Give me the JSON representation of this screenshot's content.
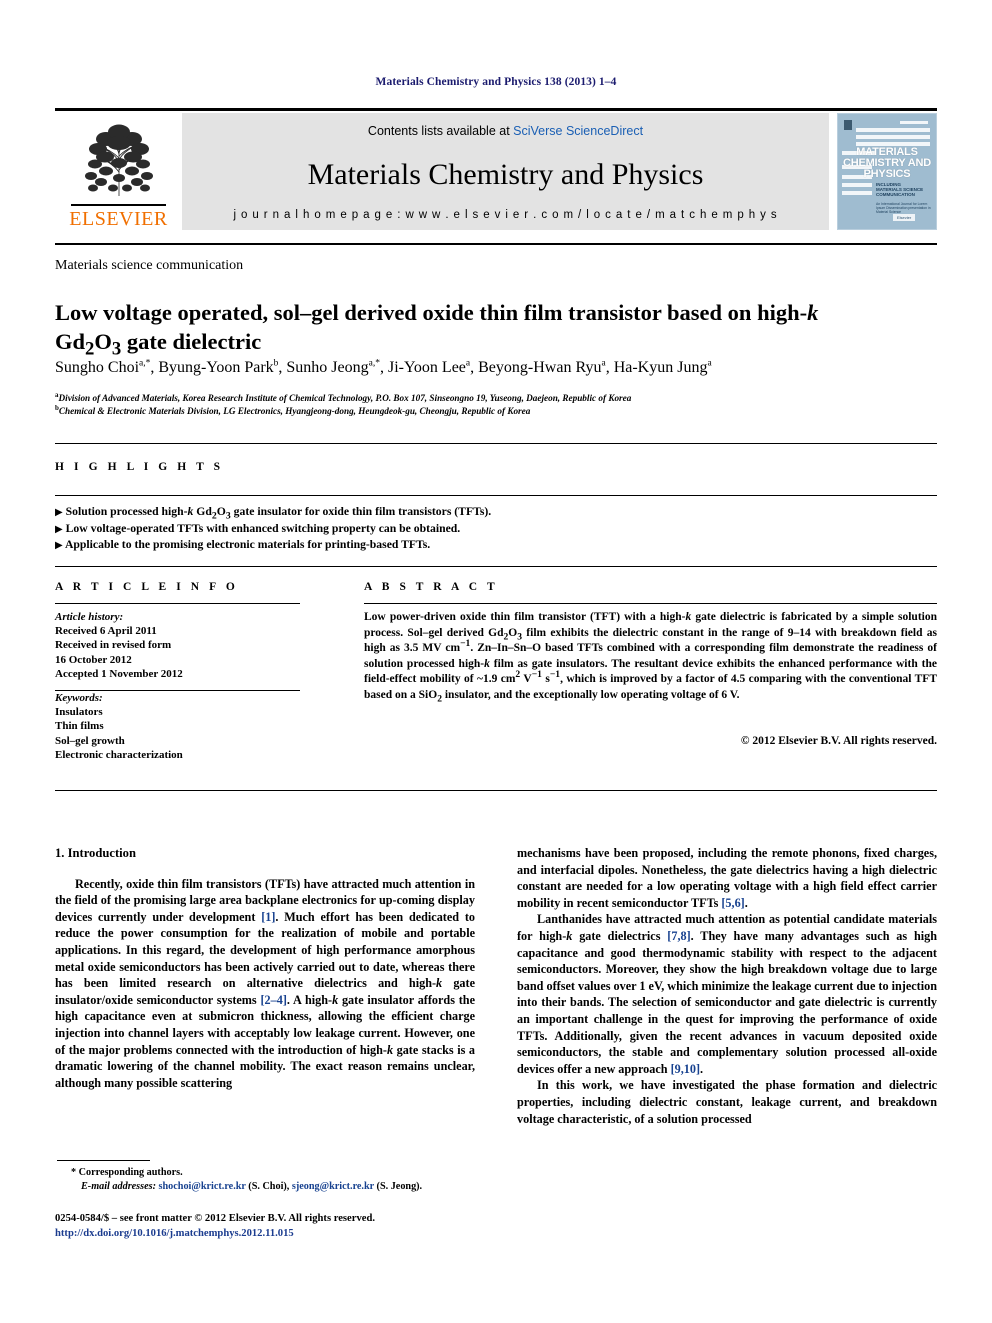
{
  "running_head": "Materials Chemistry and Physics 138 (2013) 1–4",
  "masthead": {
    "publisher_logo_text": "ELSEVIER",
    "contents_prefix": "Contents lists available at ",
    "contents_link": "SciVerse ScienceDirect",
    "journal_title": "Materials Chemistry and Physics",
    "homepage": "j o u r n a l   h o m e p a g e :   w w w . e l s e v i e r . c o m / l o c a t e / m a t c h e m p h y s",
    "cover": {
      "title_line1": "MATERIALS",
      "title_line2": "CHEMISTRY AND",
      "title_line3": "PHYSICS",
      "sub_line1": "INCLUDING",
      "sub_line2": "MATERIALS SCIENCE",
      "sub_line3": "COMMUNICATION",
      "blurb": "An International Journal for Lorem Ipsum Dissemination presentation in Material Science",
      "footer": "Elsevier"
    }
  },
  "article": {
    "section_type": "Materials science communication",
    "title_line1": "Low voltage operated, sol–gel derived oxide thin film transistor based on high-",
    "title_italic_k": "k",
    "title_line2_pre": "Gd",
    "title_line2_sub1": "2",
    "title_line2_mid": "O",
    "title_line2_sub2": "3",
    "title_line2_post": " gate dielectric",
    "authors": [
      {
        "name": "Sungho Choi",
        "marks": "a,*"
      },
      {
        "name": "Byung-Yoon Park",
        "marks": "b"
      },
      {
        "name": "Sunho Jeong",
        "marks": "a,*"
      },
      {
        "name": "Ji-Yoon Lee",
        "marks": "a"
      },
      {
        "name": "Beyong-Hwan Ryu",
        "marks": "a"
      },
      {
        "name": "Ha-Kyun Jung",
        "marks": "a"
      }
    ],
    "affiliations": [
      {
        "mark": "a",
        "text": "Division of Advanced Materials, Korea Research Institute of Chemical Technology, P.O. Box 107, Sinseongno 19, Yuseong, Daejeon, Republic of Korea"
      },
      {
        "mark": "b",
        "text": "Chemical & Electronic Materials Division, LG Electronics, Hyangjeong-dong, Heungdeok-gu, Cheongju, Republic of Korea"
      }
    ]
  },
  "highlights": {
    "heading": "H I G H L I G H T S",
    "items": [
      "Solution processed high-k Gd2O3 gate insulator for oxide thin film transistors (TFTs).",
      "Low voltage-operated TFTs with enhanced switching property can be obtained.",
      "Applicable to the promising electronic materials for printing-based TFTs."
    ],
    "bullet": "▶"
  },
  "article_info": {
    "heading": "A R T I C L E   I N F O",
    "history_label": "Article history:",
    "history": [
      "Received 6 April 2011",
      "Received in revised form",
      "16 October 2012",
      "Accepted 1 November 2012"
    ],
    "keywords_label": "Keywords:",
    "keywords": [
      "Insulators",
      "Thin films",
      "Sol–gel growth",
      "Electronic characterization"
    ]
  },
  "abstract": {
    "heading": "A B S T R A C T",
    "text_p1": "Low power-driven oxide thin film transistor (TFT) with a high-k gate dielectric is fabricated by a simple solution process. Sol–gel derived Gd2O3 film exhibits the dielectric constant in the range of 9–14 with breakdown field as high as 3.5 MV cm−1. Zn–In–Sn–O based TFTs combined with a corresponding film demonstrate the readiness of solution processed high-k film as gate insulators. The resultant device exhibits the enhanced performance with the field-effect mobility of ~1.9 cm2 V−1 s−1, which is improved by a factor of 4.5 comparing with the conventional TFT based on a SiO2 insulator, and the exceptionally low operating voltage of 6 V.",
    "copyright": "© 2012 Elsevier B.V. All rights reserved."
  },
  "body": {
    "section_number_title": "1.  Introduction",
    "left_paragraphs": [
      "Recently, oxide thin film transistors (TFTs) have attracted much attention in the field of the promising large area backplane electronics for up-coming display devices currently under development [1]. Much effort has been dedicated to reduce the power consumption for the realization of mobile and portable applications. In this regard, the development of high performance amorphous metal oxide semiconductors has been actively carried out to date, whereas there has been limited research on alternative dielectrics and high-k gate insulator/oxide semiconductor systems [2–4]. A high-k gate insulator affords the high capacitance even at submicron thickness, allowing the efficient charge injection into channel layers with acceptably low leakage current. However, one of the major problems connected with the introduction of high-k gate stacks is a dramatic lowering of the channel mobility. The exact reason remains unclear, although many possible scattering"
    ],
    "right_paragraphs": [
      "mechanisms have been proposed, including the remote phonons, fixed charges, and interfacial dipoles. Nonetheless, the gate dielectrics having a high dielectric constant are needed for a low operating voltage with a high field effect carrier mobility in recent semiconductor TFTs [5,6].",
      "Lanthanides have attracted much attention as potential candidate materials for high-k gate dielectrics [7,8]. They have many advantages such as high capacitance and good thermodynamic stability with respect to the adjacent semiconductors. Moreover, they show the high breakdown voltage due to large band offset values over 1 eV, which minimize the leakage current due to injection into their bands. The selection of semiconductor and gate dielectric is currently an important challenge in the quest for improving the performance of oxide TFTs. Additionally, given the recent advances in vacuum deposited oxide semiconductors, the stable and complementary solution processed all-oxide devices offer a new approach [9,10].",
      "In this work, we have investigated the phase formation and dielectric properties, including dielectric constant, leakage current, and breakdown voltage characteristic, of a solution processed"
    ]
  },
  "footnotes": {
    "corresponding": "* Corresponding authors.",
    "email_label": "E-mail addresses:",
    "email1": "shochoi@krict.re.kr",
    "email1_who": " (S. Choi), ",
    "email2": "sjeong@krict.re.kr",
    "email2_who": " (S. Jeong)."
  },
  "imprint": {
    "issn_line": "0254-0584/$ – see front matter © 2012 Elsevier B.V. All rights reserved.",
    "doi": "http://dx.doi.org/10.1016/j.matchemphys.2012.11.015"
  },
  "colors": {
    "link": "#1a5fb4",
    "reference": "#17418f",
    "runhead": "#1b1b6e",
    "elsevier_orange": "#f06f00",
    "masthead_bg": "#e3e3e3",
    "cover_bg": "#9fbcd0"
  }
}
